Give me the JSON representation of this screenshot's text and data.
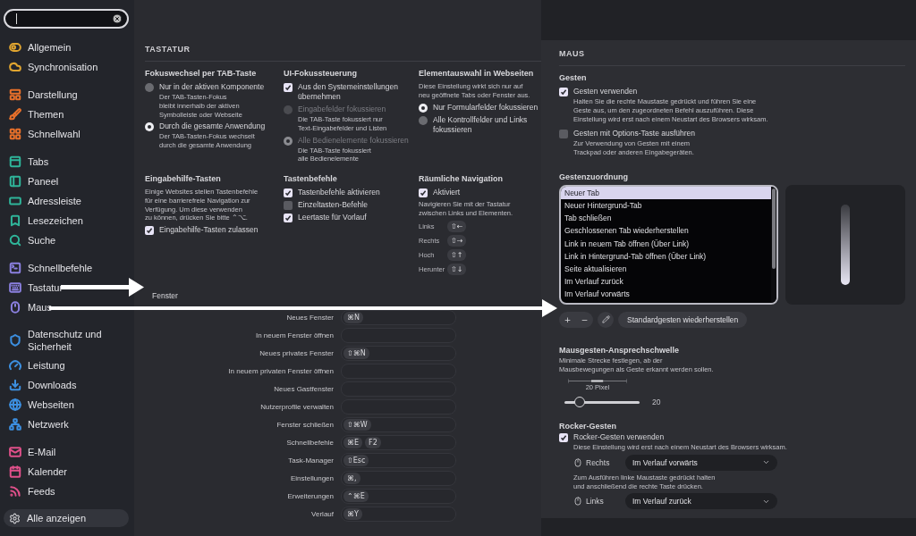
{
  "sidebar": {
    "groups": [
      {
        "items": [
          {
            "label": "Allgemein",
            "color": "#e0a530",
            "selected": false
          },
          {
            "label": "Synchronisation",
            "color": "#e0a530",
            "selected": false
          }
        ]
      },
      {
        "items": [
          {
            "label": "Darstellung",
            "color": "#e8702a",
            "selected": false
          },
          {
            "label": "Themen",
            "color": "#e8702a",
            "selected": false
          },
          {
            "label": "Schnellwahl",
            "color": "#e8702a",
            "selected": false
          }
        ]
      },
      {
        "items": [
          {
            "label": "Tabs",
            "color": "#2fb59a",
            "selected": false
          },
          {
            "label": "Paneel",
            "color": "#2fb59a",
            "selected": false
          },
          {
            "label": "Adressleiste",
            "color": "#2fb59a",
            "selected": false
          },
          {
            "label": "Lesezeichen",
            "color": "#2fb59a",
            "selected": false
          },
          {
            "label": "Suche",
            "color": "#2fb59a",
            "selected": false
          }
        ]
      },
      {
        "items": [
          {
            "label": "Schnellbefehle",
            "color": "#8b80e0",
            "selected": false
          },
          {
            "label": "Tastatur",
            "color": "#8b80e0",
            "selected": false
          },
          {
            "label": "Maus",
            "color": "#8b80e0",
            "selected": false
          }
        ]
      },
      {
        "items": [
          {
            "label": "Datenschutz und Sicherheit",
            "color": "#3c8fe0",
            "selected": false
          },
          {
            "label": "Leistung",
            "color": "#3c8fe0",
            "selected": false
          },
          {
            "label": "Downloads",
            "color": "#3c8fe0",
            "selected": false
          },
          {
            "label": "Webseiten",
            "color": "#3c8fe0",
            "selected": false
          },
          {
            "label": "Netzwerk",
            "color": "#3c8fe0",
            "selected": false
          }
        ]
      },
      {
        "items": [
          {
            "label": "E-Mail",
            "color": "#e0508a",
            "selected": false
          },
          {
            "label": "Kalender",
            "color": "#e0508a",
            "selected": false
          },
          {
            "label": "Feeds",
            "color": "#e0508a",
            "selected": false
          }
        ]
      }
    ],
    "footer_button": "Alle anzeigen"
  },
  "keyboard": {
    "title": "TASTATUR",
    "sections": [
      {
        "heading": "Fokuswechsel per TAB-Taste",
        "items": [
          {
            "kind": "radio",
            "label": "Nur in der aktiven Komponente",
            "note": "Der TAB-Tasten-Fokus\nbleibt innerhalb der aktiven\nSymbolleiste oder Webseite",
            "selected": false,
            "disabled": false
          },
          {
            "kind": "radio",
            "label": "Durch die gesamte Anwendung",
            "note": "Der TAB-Tasten-Fokus wechselt\ndurch die gesamte Anwendung",
            "selected": true,
            "disabled": false
          }
        ]
      },
      {
        "heading": "UI-Fokussteuerung",
        "items": [
          {
            "kind": "checkbox",
            "label": "Aus den Systemeinstellungen\nübernehmen",
            "checked": true,
            "disabled": false
          },
          {
            "kind": "radio",
            "label": "Eingabefelder fokussieren",
            "note": "Die TAB-Taste fokussiert nur\nText-Eingabefelder und Listen",
            "selected": false,
            "disabled": true
          },
          {
            "kind": "radio",
            "label": "Alle Bedienelemente fokussieren",
            "note": "Die TAB-Taste fokussiert\nalle Bedienelemente",
            "selected": true,
            "disabled": true
          }
        ]
      },
      {
        "heading": "Elementauswahl in Webseiten",
        "items": [
          {
            "kind": "text",
            "text": "Diese Einstellung wirkt sich nur auf\nneu geöffnete Tabs oder Fenster aus."
          },
          {
            "kind": "radio",
            "label": "Nur Formularfelder fokussieren",
            "selected": true,
            "disabled": false
          },
          {
            "kind": "radio",
            "label": "Alle Kontrollfelder und Links\nfokussieren",
            "selected": false,
            "disabled": false
          }
        ]
      },
      {
        "heading": "Eingabehilfe-Tasten",
        "items": [
          {
            "kind": "text",
            "text": "Einige Websites stellen Tastenbefehle\nfür eine barrierefreie Navigation zur\nVerfügung. Um diese verwenden\nzu können, drücken Sie bitte ⌃⌥."
          },
          {
            "kind": "checkbox",
            "label": "Eingabehilfe-Tasten zulassen",
            "checked": true,
            "disabled": false
          }
        ]
      },
      {
        "heading": "Tastenbefehle",
        "items": [
          {
            "kind": "checkbox",
            "label": "Tastenbefehle aktivieren",
            "checked": true,
            "disabled": false
          },
          {
            "kind": "checkbox",
            "label": "Einzeltasten-Befehle",
            "checked": false,
            "disabled": false
          },
          {
            "kind": "checkbox",
            "label": "Leertaste für Vorlauf",
            "checked": true,
            "disabled": false
          }
        ]
      },
      {
        "heading": "Räumliche Navigation",
        "items": [
          {
            "kind": "checkbox",
            "label": "Aktiviert",
            "checked": true,
            "disabled": false
          },
          {
            "kind": "text",
            "text": "Navigieren Sie mit der Tastatur\nzwischen Links und Elementen."
          },
          {
            "kind": "shortcut",
            "label": "Links",
            "key": "⇧←"
          },
          {
            "kind": "shortcut",
            "label": "Rechts",
            "key": "⇧→"
          },
          {
            "kind": "shortcut",
            "label": "Hoch",
            "key": "⇧↑"
          },
          {
            "kind": "shortcut",
            "label": "Herunter",
            "key": "⇧↓"
          }
        ]
      }
    ]
  },
  "windows": {
    "heading": "Fenster",
    "rows": [
      {
        "label": "Neues Fenster",
        "keys": [
          "⌘N"
        ]
      },
      {
        "label": "In neuem Fenster öffnen"
      },
      {
        "label": "Neues privates Fenster",
        "keys": [
          "⇧⌘N"
        ]
      },
      {
        "label": "In neuem privaten Fenster öffnen"
      },
      {
        "label": "Neues Gastfenster"
      },
      {
        "label": "Nutzerprofile verwalten"
      },
      {
        "label": "Fenster schließen",
        "keys": [
          "⇧⌘W"
        ]
      },
      {
        "label": "Schnellbefehle",
        "keys": [
          "⌘E",
          "F2"
        ]
      },
      {
        "label": "Task-Manager",
        "keys": [
          "⇧Esc"
        ]
      },
      {
        "label": "Einstellungen",
        "keys": [
          "⌘,"
        ]
      },
      {
        "label": "Erweiterungen",
        "keys": [
          "⌃⌘E"
        ]
      },
      {
        "label": "Verlauf",
        "keys": [
          "⌘Y"
        ]
      }
    ]
  },
  "mouse": {
    "title": "MAUS",
    "gestures": {
      "heading": "Gesten",
      "options": [
        {
          "label": "Gesten verwenden",
          "note": "Halten Sie die rechte Maustaste gedrückt und führen Sie eine\nGeste aus, um den zugeordneten Befehl auszuführen. Diese\nEinstellung wird erst nach einem Neustart des Browsers wirksam.",
          "checked": true
        },
        {
          "label": "Gesten mit Options-Taste ausführen",
          "note": "Zur Verwendung von Gesten mit einem\nTrackpad oder anderen Eingabegeräten.",
          "checked": false
        }
      ]
    },
    "mapping": {
      "heading": "Gestenzuordnung",
      "items": [
        {
          "label": "Neuer Tab",
          "selected": true
        },
        {
          "label": "Neuer Hintergrund-Tab",
          "selected": false
        },
        {
          "label": "Tab schließen",
          "selected": false
        },
        {
          "label": "Geschlossenen Tab wiederherstellen",
          "selected": false
        },
        {
          "label": "Link in neuem Tab öffnen (Über Link)",
          "selected": false
        },
        {
          "label": "Link in Hintergrund-Tab öffnen (Über Link)",
          "selected": false
        },
        {
          "label": "Seite aktualisieren",
          "selected": false
        },
        {
          "label": "Im Verlauf zurück",
          "selected": false
        },
        {
          "label": "Im Verlauf vorwärts",
          "selected": false
        }
      ],
      "add": "+",
      "remove": "−",
      "reset": "Standardgesten wiederherstellen"
    },
    "threshold": {
      "heading": "Mausgesten-Ansprechschwelle",
      "description": "Minimale Strecke festlegen, ab der\nMausbewegungen als Geste erkannt werden sollen.",
      "preview_label": "20 Pixel",
      "level": 0.2,
      "value": "20"
    },
    "rocker": {
      "heading": "Rocker-Gesten",
      "option": {
        "label": "Rocker-Gesten verwenden",
        "note": "Diese Einstellung wird erst nach einem Neustart des Browsers wirksam.",
        "checked": true
      },
      "items": [
        {
          "kind": "select",
          "label": "Rechts",
          "value": "Im Verlauf vorwärts"
        },
        {
          "kind": "text",
          "text": "Zum Ausführen linke Maustaste gedrückt halten\nund anschließend die rechte Taste drücken."
        },
        {
          "kind": "select",
          "label": "Links",
          "value": "Im Verlauf zurück"
        }
      ]
    }
  }
}
